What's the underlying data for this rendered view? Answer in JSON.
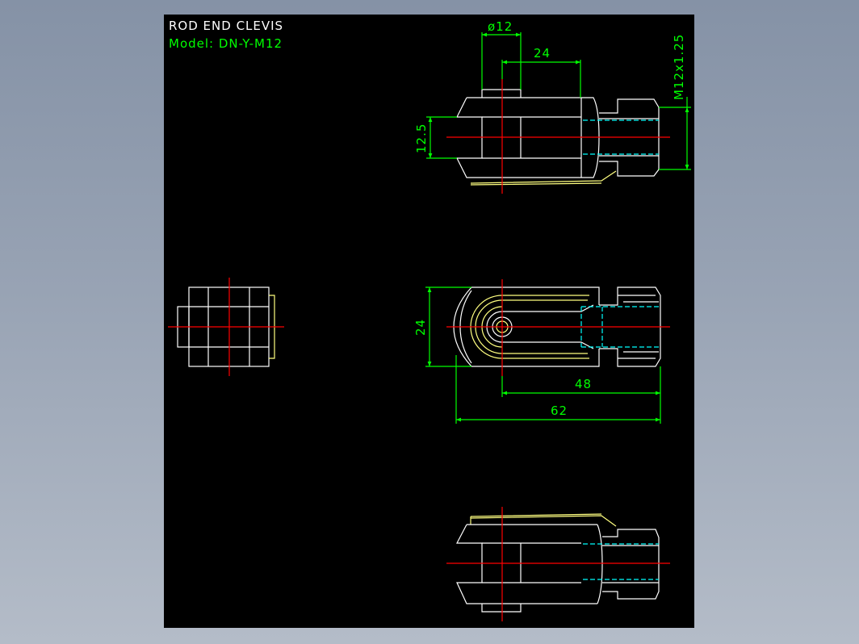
{
  "title": "ROD END CLEVIS",
  "model": "Model: DN-Y-M12",
  "dimensions": {
    "pin_diameter": "ø12",
    "top_length": "24",
    "thread": "M12x1.25",
    "slot_width": "12.5",
    "side_height": "24",
    "pin_to_end": "48",
    "overall_length": "62"
  },
  "colors": {
    "background": "#000000",
    "outline": "#ffffff",
    "dimension": "#00ff00",
    "centerline": "#ff0000",
    "hidden": "#00ffff",
    "detail": "#ffff80"
  }
}
